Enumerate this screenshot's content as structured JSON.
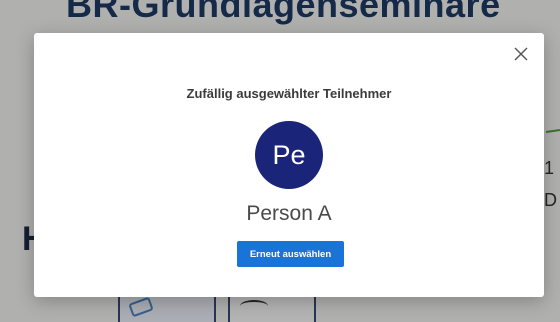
{
  "background": {
    "title": "BR-Grundlagenseminare",
    "left_fragment": "H",
    "right_fragment_1": "1",
    "right_fragment_2": "D"
  },
  "modal": {
    "title": "Zufällig ausgewählter Teilnehmer",
    "avatar_initials": "Pe",
    "person_name": "Person A",
    "reselect_label": "Erneut auswählen",
    "close_icon": "close-icon"
  },
  "colors": {
    "avatar_bg": "#1a2478",
    "primary_button": "#1a73d8"
  }
}
